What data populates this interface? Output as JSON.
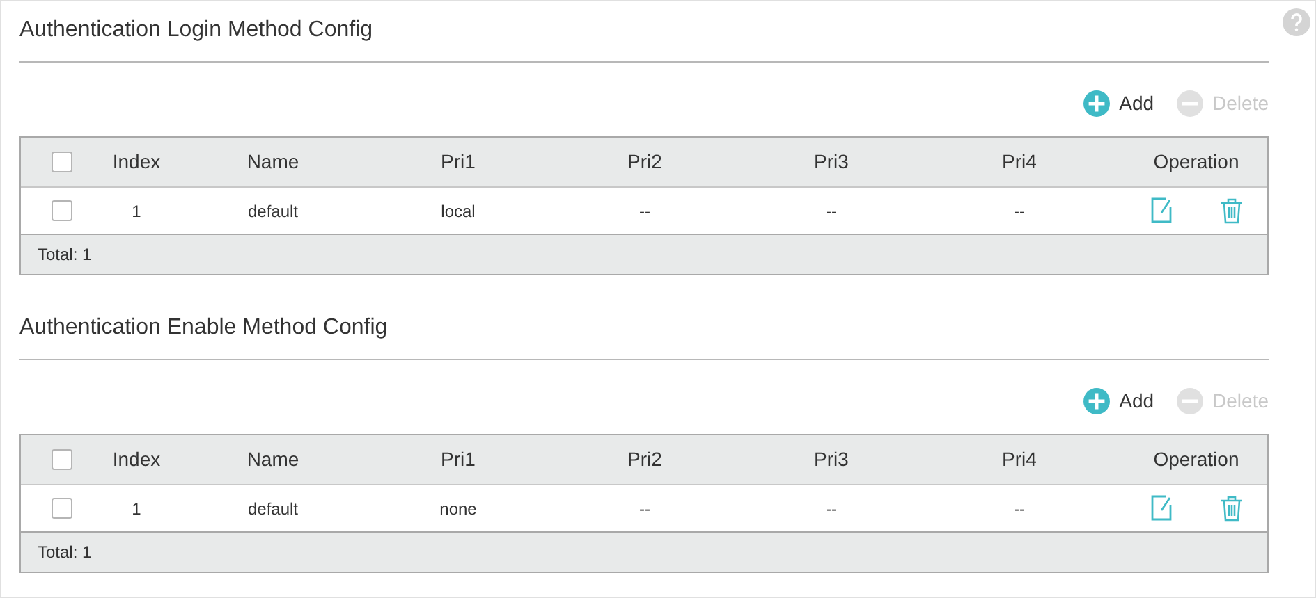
{
  "sections": [
    {
      "title": "Authentication Login Method Config",
      "buttons": [
        {
          "kind": "add",
          "label": "Add",
          "disabled": false
        },
        {
          "kind": "delete",
          "label": "Delete",
          "disabled": true
        }
      ],
      "table": {
        "select_all_checked": false,
        "columns": [
          "Index",
          "Name",
          "Pri1",
          "Pri2",
          "Pri3",
          "Pri4",
          "Operation"
        ],
        "rows": [
          {
            "checked": false,
            "cells": [
              "1",
              "default",
              "local",
              "--",
              "--",
              "--"
            ]
          }
        ],
        "footer": "Total: 1"
      }
    },
    {
      "title": "Authentication Enable Method Config",
      "buttons": [
        {
          "kind": "add",
          "label": "Add",
          "disabled": false
        },
        {
          "kind": "delete",
          "label": "Delete",
          "disabled": true
        }
      ],
      "table": {
        "select_all_checked": false,
        "columns": [
          "Index",
          "Name",
          "Pri1",
          "Pri2",
          "Pri3",
          "Pri4",
          "Operation"
        ],
        "rows": [
          {
            "checked": false,
            "cells": [
              "1",
              "default",
              "none",
              "--",
              "--",
              "--"
            ]
          }
        ],
        "footer": "Total: 1"
      }
    }
  ]
}
